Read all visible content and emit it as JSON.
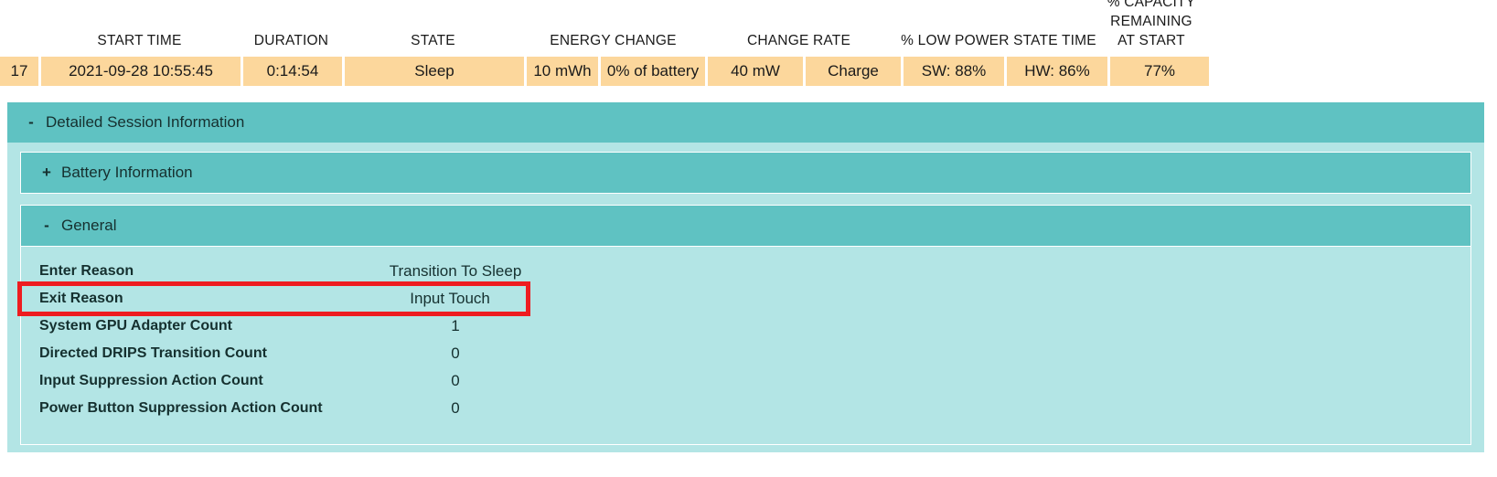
{
  "summary_table": {
    "columns": [
      {
        "key": "index",
        "label": ""
      },
      {
        "key": "start_time",
        "label": "START TIME"
      },
      {
        "key": "duration",
        "label": "DURATION"
      },
      {
        "key": "state",
        "label": "STATE"
      },
      {
        "key": "energy_change",
        "label": "ENERGY CHANGE"
      },
      {
        "key": "change_rate",
        "label": "CHANGE RATE"
      },
      {
        "key": "low_power_state_time",
        "label": "% LOW POWER STATE TIME"
      },
      {
        "key": "capacity_remaining",
        "label": "% CAPACITY REMAINING AT START"
      }
    ],
    "header_labels": {
      "start_time": "START TIME",
      "duration": "DURATION",
      "state": "STATE",
      "energy_change": "ENERGY CHANGE",
      "change_rate": "CHANGE RATE",
      "low_power_state_time": "% LOW POWER STATE TIME",
      "capacity_line1": "% CAPACITY",
      "capacity_line2": "REMAINING",
      "capacity_line3": "AT START"
    },
    "row": {
      "index": "17",
      "start_time": "2021-09-28   10:55:45",
      "duration": "0:14:54",
      "state": "Sleep",
      "energy_change_value": "10 mWh",
      "energy_change_percent": "0% of battery",
      "change_rate_value": "40 mW",
      "change_rate_state": "Charge",
      "low_power_sw": "SW: 88%",
      "low_power_hw": "HW: 86%",
      "capacity_remaining": "77%"
    }
  },
  "detailed_session": {
    "title": "Detailed Session Information",
    "expander": "-",
    "sections": [
      {
        "title": "Battery Information",
        "expander": "+",
        "expanded": false
      },
      {
        "title": "General",
        "expander": "-",
        "expanded": true
      }
    ],
    "general_rows": [
      {
        "label": "Enter Reason",
        "value": "Transition To Sleep",
        "highlighted": false
      },
      {
        "label": "Exit Reason",
        "value": "Input Touch",
        "highlighted": true
      },
      {
        "label": "System GPU Adapter Count",
        "value": "1",
        "highlighted": false
      },
      {
        "label": "Directed DRIPS Transition Count",
        "value": "0",
        "highlighted": false
      },
      {
        "label": "Input Suppression Action Count",
        "value": "0",
        "highlighted": false
      },
      {
        "label": "Power Button Suppression Action Count",
        "value": "0",
        "highlighted": false
      }
    ]
  },
  "colors": {
    "table_row_background": "#fcd79c",
    "panel_header_teal": "#5fc2c2",
    "panel_body_teal": "#b3e5e5",
    "highlight_red": "#ee1c20",
    "page_background": "#ffffff",
    "text": "#1a1a1a"
  }
}
